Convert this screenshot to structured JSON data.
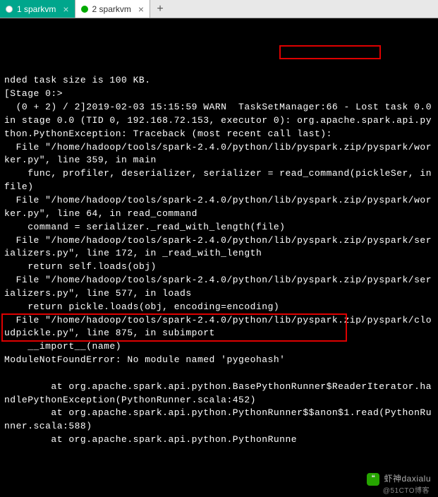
{
  "tabs": [
    {
      "label": "1 sparkvm",
      "active": true
    },
    {
      "label": "2 sparkvm",
      "active": false
    }
  ],
  "highlights": {
    "ip": "192.168.72.153",
    "error": "ModuleNotFoundError: No module named 'pygeohash'"
  },
  "terminal_lines": [
    "nded task size is 100 KB.",
    "[Stage 0:>",
    "  (0 + 2) / 2]2019-02-03 15:15:59 WARN  TaskSetManager:66 - Lost task 0.0 in stage 0.0 (TID 0, 192.168.72.153, executor 0): org.apache.spark.api.python.PythonException: Traceback (most recent call last):",
    "  File \"/home/hadoop/tools/spark-2.4.0/python/lib/pyspark.zip/pyspark/worker.py\", line 359, in main",
    "    func, profiler, deserializer, serializer = read_command(pickleSer, infile)",
    "  File \"/home/hadoop/tools/spark-2.4.0/python/lib/pyspark.zip/pyspark/worker.py\", line 64, in read_command",
    "    command = serializer._read_with_length(file)",
    "  File \"/home/hadoop/tools/spark-2.4.0/python/lib/pyspark.zip/pyspark/serializers.py\", line 172, in _read_with_length",
    "    return self.loads(obj)",
    "  File \"/home/hadoop/tools/spark-2.4.0/python/lib/pyspark.zip/pyspark/serializers.py\", line 577, in loads",
    "    return pickle.loads(obj, encoding=encoding)",
    "  File \"/home/hadoop/tools/spark-2.4.0/python/lib/pyspark.zip/pyspark/cloudpickle.py\", line 875, in subimport",
    "    __import__(name)",
    "ModuleNotFoundError: No module named 'pygeohash'",
    "",
    "        at org.apache.spark.api.python.BasePythonRunner$ReaderIterator.handlePythonException(PythonRunner.scala:452)",
    "        at org.apache.spark.api.python.PythonRunner$$anon$1.read(PythonRunner.scala:588)",
    "        at org.apache.spark.api.python.PythonRunne"
  ],
  "watermark": {
    "text1": "虾神daxialu",
    "text2": "@51CTO博客"
  }
}
